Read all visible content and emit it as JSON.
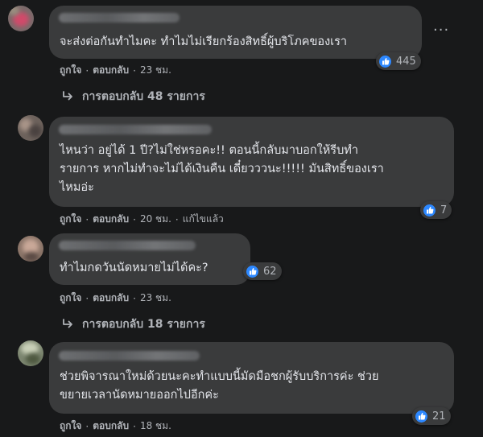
{
  "comments": [
    {
      "text_lines": [
        "จะส่งต่อกันทำไมคะ ทำไมไม่เรียกร้องสิทธิ์ผู้บริโภคของเรา"
      ],
      "reaction_count": "445",
      "actions": {
        "like": "ถูกใจ",
        "reply": "ตอบกลับ",
        "time": "23 ชม."
      },
      "replies_label": "การตอบกลับ 48 รายการ",
      "avatar_color": "#b8485a"
    },
    {
      "text_lines": [
        "ไหนว่า อยู่ได้ 1 ปี?ไม่ใช่หรอคะ!! ตอนนี้กลับมาบอกให้รีบทำ",
        "รายการ หากไม่ทำจะไม่ได้เงินคืน เดี๋ยวววนะ!!!!! มันสิทธิ์ของเรา",
        "ไหมอ่ะ"
      ],
      "reaction_count": "7",
      "actions": {
        "like": "ถูกใจ",
        "reply": "ตอบกลับ",
        "time": "20 ชม.",
        "edited": "แก้ไขแล้ว"
      },
      "avatar_color": "#8a7a70"
    },
    {
      "text_lines": [
        "ทำไมกดวันนัดหมายไม่ได้คะ?"
      ],
      "reaction_count": "62",
      "actions": {
        "like": "ถูกใจ",
        "reply": "ตอบกลับ",
        "time": "23 ชม."
      },
      "replies_label": "การตอบกลับ 18 รายการ",
      "avatar_color": "#b08a78"
    },
    {
      "text_lines": [
        "ช่วยพิจารณาใหม่ด้วยนะคะทำแบบนี้มัดมือชกผู้รับบริการค่ะ ช่วย",
        "ขยายเวลานัดหมายออกไปอีกค่ะ"
      ],
      "reaction_count": "21",
      "actions": {
        "like": "ถูกใจ",
        "reply": "ตอบกลับ",
        "time": "18 ชม."
      },
      "avatar_color": "#9aa58a"
    }
  ],
  "colors": {
    "background": "#18191a",
    "bubble": "#3a3b3c",
    "text": "#e4e6eb",
    "secondary_text": "#b0b3b8",
    "like_blue": "#2d88ff"
  },
  "icons": {
    "like": "thumbs-up-icon",
    "reply_arrow": "reply-arrow-icon",
    "more": "more-options-icon"
  }
}
